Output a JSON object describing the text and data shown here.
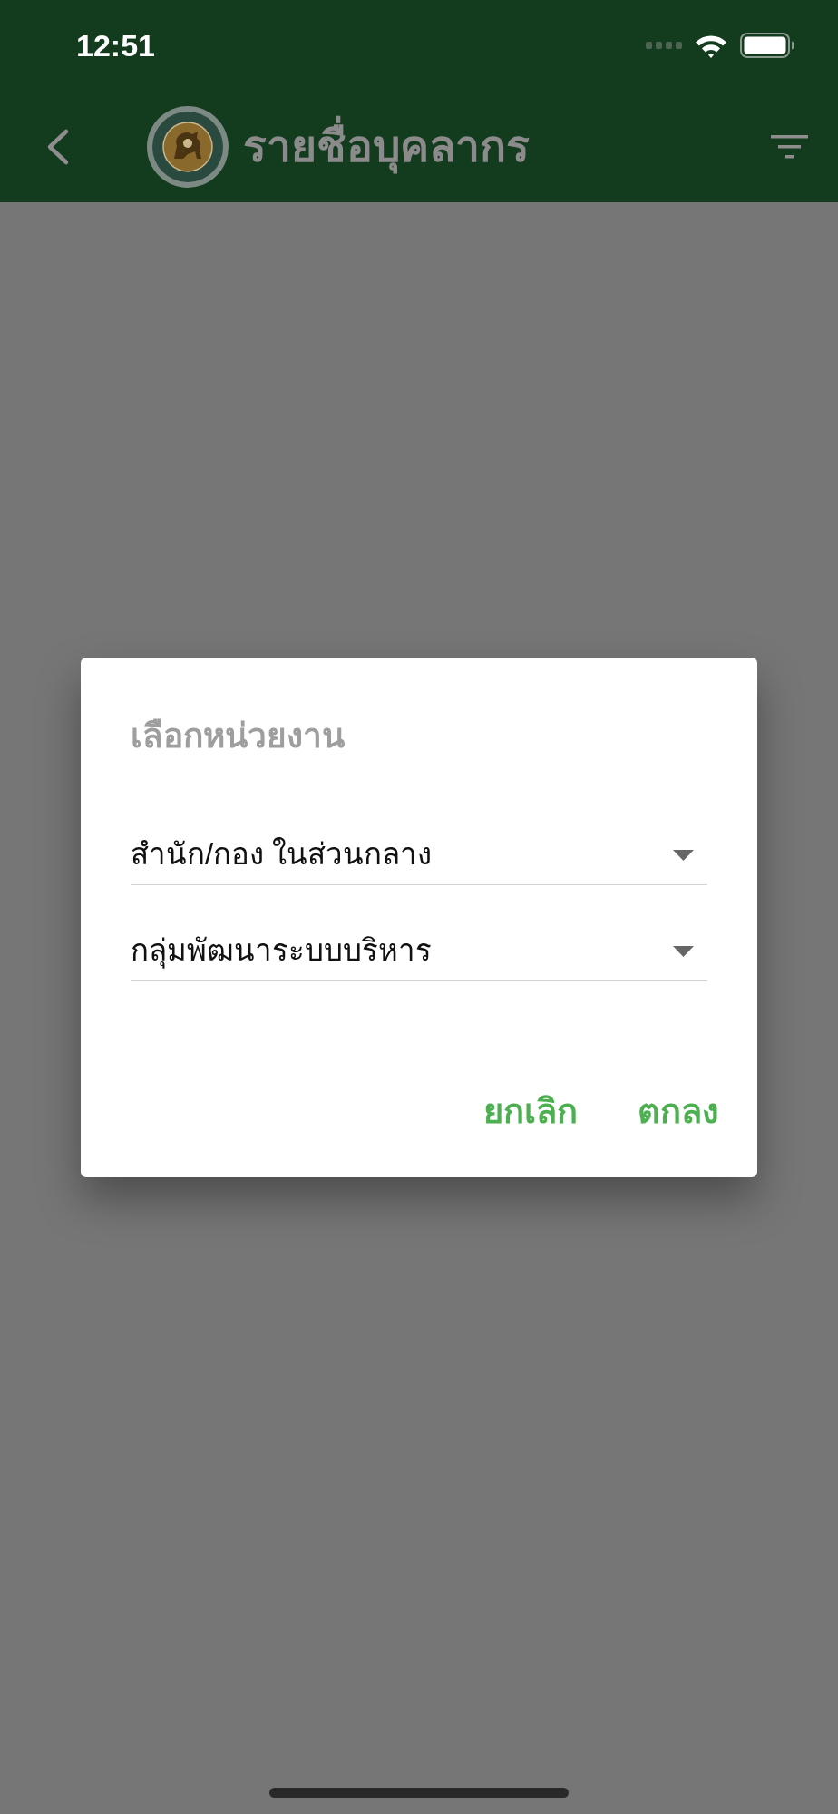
{
  "status_bar": {
    "time": "12:51"
  },
  "header": {
    "title": "รายชื่อบุคลากร"
  },
  "dialog": {
    "title": "เลือกหน่วยงาน",
    "dropdowns": [
      {
        "value": "สำนัก/กอง ในส่วนกลาง"
      },
      {
        "value": "กลุ่มพัฒนาระบบบริหาร"
      }
    ],
    "buttons": [
      {
        "label": "ยกเลิก"
      },
      {
        "label": "ตกลง"
      }
    ]
  }
}
